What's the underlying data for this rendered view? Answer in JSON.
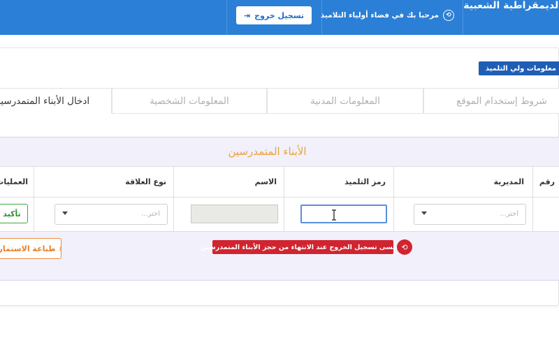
{
  "header": {
    "brand": "الديمقراطية الشعبية",
    "welcome": "مرحبا بك في فضاء أولياء التلاميذ",
    "logout_label": "تسجيل خروج"
  },
  "badge": "معلومات ولي التلميذ",
  "tabs": [
    {
      "label": "شروط إستخدام الموقع"
    },
    {
      "label": "المعلومات المدنية"
    },
    {
      "label": "المعلومات الشخصية"
    },
    {
      "label": "ادخال الأبناء المتمدرسين"
    }
  ],
  "panel": {
    "title": "الأبناء المتمدرسين",
    "columns": {
      "number": "رقم",
      "directorate": "المديرية",
      "student_code": "رمز التلميذ",
      "name": "الاسم",
      "relation": "نوع العلاقة",
      "operations": "العمليات"
    },
    "row": {
      "directorate_placeholder": "اختر...",
      "relation_placeholder": "اختر...",
      "student_code_value": "",
      "name_value": "",
      "confirm_label": "تأكيد"
    },
    "warning": "لا تنسى تسجيل الخروج عند الانتهاء من حجز الأبناء المتمدرسين",
    "print_label": "طباعة الاستمارة"
  },
  "colors": {
    "header_bg": "#2b7fd6",
    "badge_bg": "#1f5eb5",
    "title": "#e8a33d",
    "warning_bg": "#d02530",
    "confirm": "#3ea83e",
    "print": "#f08c3c"
  }
}
